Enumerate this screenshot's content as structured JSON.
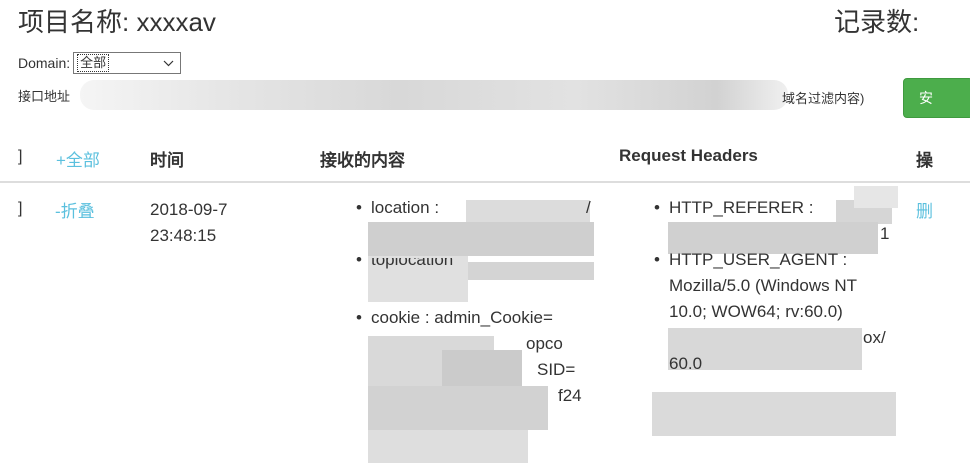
{
  "header": {
    "project_title": "项目名称: xxxxav",
    "record_count_label": "记录数:"
  },
  "filter": {
    "domain_label": "Domain:",
    "domain_selected": "全部",
    "api_label": "接口地址",
    "filter_hint": "域名过滤内容)",
    "submit_label": "安"
  },
  "table": {
    "columns": {
      "bracket": "]",
      "expand_all": "+全部",
      "time": "时间",
      "content": "接收的内容",
      "headers": "Request Headers",
      "actions": "操"
    },
    "rows": [
      {
        "bracket": "]",
        "toggle": "-折叠",
        "date": "2018-09-7",
        "time": "23:48:15",
        "content_items": [
          {
            "label": "location :",
            "tail": "/"
          },
          {
            "label": "toplocation",
            "tail": ""
          },
          {
            "label": "cookie : admin_Cookie=",
            "extra1": "opco",
            "extra2": "SID=",
            "extra3": "f24"
          }
        ],
        "header_items": [
          {
            "label": "HTTP_REFERER :",
            "tail": "1"
          },
          {
            "label": "HTTP_USER_AGENT :",
            "line2": "Mozilla/5.0 (Windows NT",
            "line3": "10.0; WOW64; rv:60.0)",
            "line4_tail": "ox/",
            "line5": "60.0"
          }
        ],
        "action": "删"
      }
    ]
  }
}
